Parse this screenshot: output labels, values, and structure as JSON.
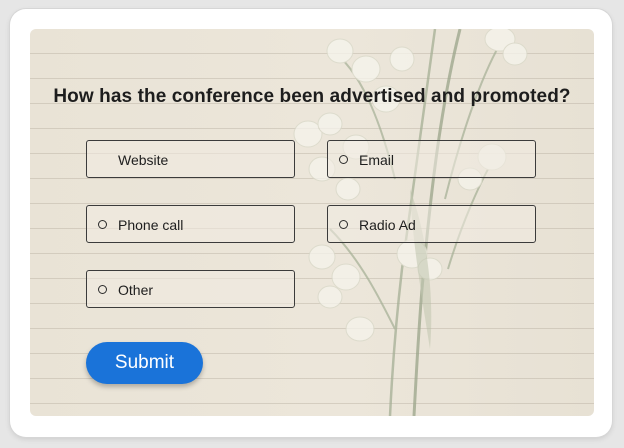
{
  "form": {
    "question": "How has the conference been advertised and promoted?",
    "options": [
      {
        "label": "Website",
        "has_radio": false
      },
      {
        "label": "Email",
        "has_radio": true
      },
      {
        "label": "Phone call",
        "has_radio": true
      },
      {
        "label": "Radio Ad",
        "has_radio": true
      },
      {
        "label": "Other",
        "has_radio": true
      }
    ],
    "submit_label": "Submit"
  },
  "colors": {
    "accent": "#1a73d9",
    "panel_background": "#ebe4d8",
    "border": "#3b3b3b"
  },
  "background_image": "lily-of-the-valley-flowers-on-lined-paper"
}
